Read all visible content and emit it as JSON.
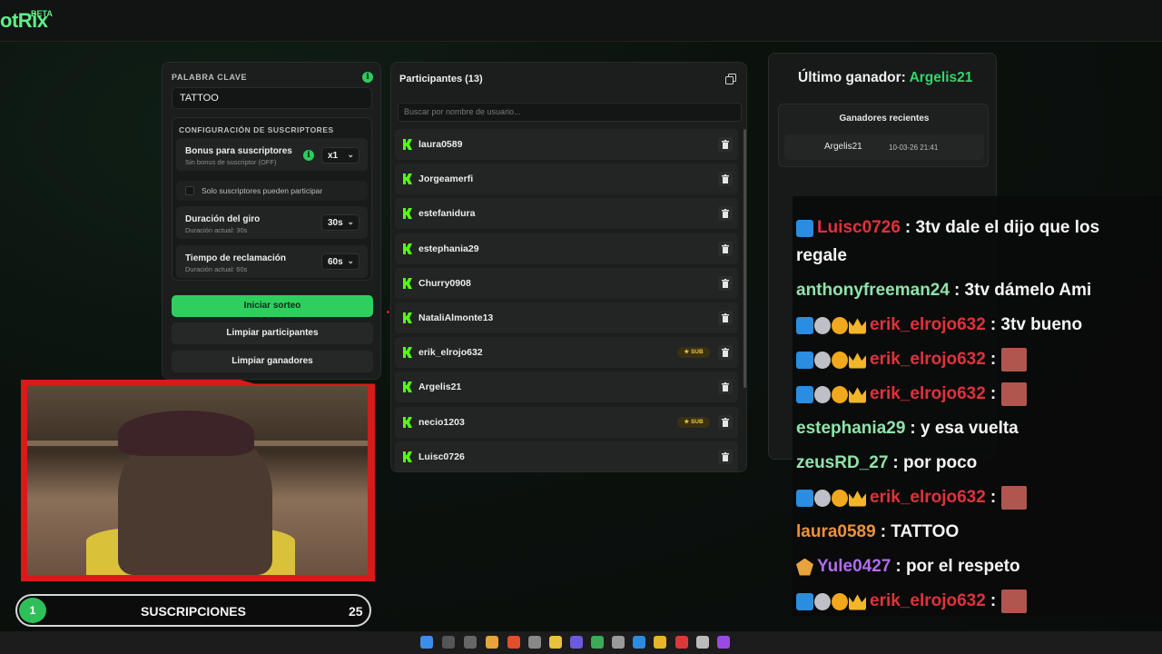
{
  "app": {
    "logo": "otRix",
    "badge": "BETA"
  },
  "settings": {
    "keyword_label": "PALABRA CLAVE",
    "keyword_value": "TATTOO",
    "info_glyph": "i",
    "subs_config_title": "CONFIGURACIÓN DE SUSCRIPTORES",
    "bonus": {
      "title": "Bonus para suscriptores",
      "subtitle": "Sin bonus de suscriptor (OFF)",
      "value": "x1"
    },
    "subs_only_label": "Solo suscriptores pueden participar",
    "spin": {
      "title": "Duración del giro",
      "subtitle": "Duración actual: 30s",
      "value": "30s"
    },
    "claim": {
      "title": "Tiempo de reclamación",
      "subtitle": "Duración actual: 60s",
      "value": "60s"
    },
    "start_button": "Iniciar sorteo",
    "clear_participants_button": "Limpiar participantes",
    "clear_winners_button": "Limpiar ganadores"
  },
  "participants": {
    "title": "Participantes (13)",
    "search_placeholder": "Buscar por nombre de usuario...",
    "sub_badge": "SUB",
    "items": [
      {
        "name": "laura0589",
        "sub": false
      },
      {
        "name": "Jorgeamerfi",
        "sub": false
      },
      {
        "name": "estefanidura",
        "sub": false
      },
      {
        "name": "estephania29",
        "sub": false
      },
      {
        "name": "Churry0908",
        "sub": false
      },
      {
        "name": "NataliAlmonte13",
        "sub": false
      },
      {
        "name": "erik_elrojo632",
        "sub": true
      },
      {
        "name": "Argelis21",
        "sub": false
      },
      {
        "name": "necio1203",
        "sub": true
      },
      {
        "name": "Luisc0726",
        "sub": false
      }
    ]
  },
  "winners": {
    "last_label": "Último ganador:",
    "last_name": "Argelis21",
    "recent_title": "Ganadores recientes",
    "recent": [
      {
        "name": "Argelis21",
        "time": "10-03-26 21:41"
      }
    ]
  },
  "chat": [
    {
      "user": "Luisc0726",
      "text": ": 3tv dale el dijo que los",
      "cont": "regale",
      "color": "red"
    },
    {
      "user": "anthonyfreeman24",
      "text": ": 3tv dámelo Ami",
      "color": "mint"
    },
    {
      "user": "erik_elrojo632",
      "text": ": 3tv bueno",
      "color": "red"
    },
    {
      "user": "erik_elrojo632",
      "text": ":",
      "color": "red",
      "emote": true
    },
    {
      "user": "erik_elrojo632",
      "text": ":",
      "color": "red",
      "emote": true
    },
    {
      "user": "estephania29",
      "text": ": y esa vuelta",
      "color": "mint"
    },
    {
      "user": "zeusRD_27",
      "text": ": por poco",
      "color": "mint"
    },
    {
      "user": "erik_elrojo632",
      "text": ":",
      "color": "red",
      "emote": true
    },
    {
      "user": "laura0589",
      "text": ": TATTOO",
      "color": "orange"
    },
    {
      "user": "Yule0427",
      "text": ": por el respeto",
      "color": "purple"
    },
    {
      "user": "erik_elrojo632",
      "text": ":",
      "color": "red",
      "emote": true
    }
  ],
  "overlay": {
    "subs_label": "SUSCRIPCIONES",
    "subs_count": "25",
    "subs_level": "1"
  }
}
